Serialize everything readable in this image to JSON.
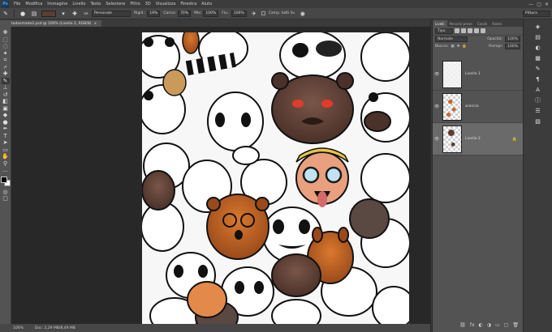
{
  "app": {
    "logo": "Ps"
  },
  "menu": [
    "File",
    "Modifica",
    "Immagine",
    "Livello",
    "Testo",
    "Selezione",
    "Filtro",
    "3D",
    "Visualizza",
    "Finestra",
    "Aiuto"
  ],
  "window_controls": [
    "—",
    "▢",
    "✕"
  ],
  "options": {
    "mode_label": "Personale",
    "size_label": "Rigid.:",
    "size_value": "19%",
    "opacity_label": "Carico:",
    "opacity_value": "70%",
    "mix_label": "Mix:",
    "mix_value": "100%",
    "flow_label": "Flu.:",
    "flow_value": "100%",
    "sample_label": "Camp. tutti liv.",
    "workspace_value": "Pittura"
  },
  "document": {
    "tab_title": "todosmade2.psd @ 100% (Livello 2, RGB/8)",
    "close": "×"
  },
  "status": {
    "zoom": "100%",
    "doc_info": "Doc: 2,29 MB/8,49 MB"
  },
  "panel": {
    "tabs": [
      "Livelli",
      "Percorsi prese",
      "Canali",
      "Azioni"
    ],
    "filter_label": "Tipo",
    "blend_mode": "Normale",
    "opacity_label": "Opacità:",
    "opacity_value": "100%",
    "lock_label": "Blocca:",
    "fill_label": "Riempi:",
    "fill_value": "100%",
    "layers": [
      {
        "name": "Livello 1",
        "selected": false
      },
      {
        "name": "arancio",
        "selected": false
      },
      {
        "name": "Livello 2",
        "selected": true
      }
    ]
  },
  "colors": {
    "accent": "#4fa3f0",
    "fg": "#000000",
    "bg": "#ffffff",
    "brown": "#5a3d33",
    "orange": "#c8692a"
  }
}
